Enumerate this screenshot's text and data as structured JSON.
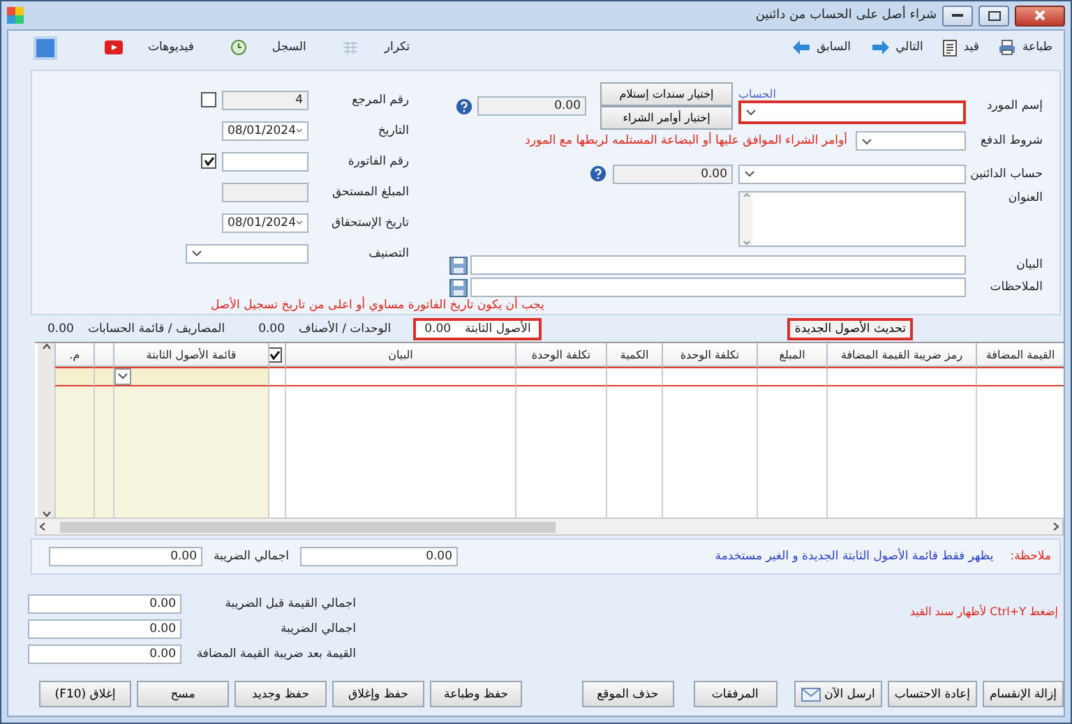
{
  "window": {
    "title": "شراء أصل على الحساب من دائنين"
  },
  "toolbar": {
    "right": [
      {
        "label": "طباعة",
        "kind": "printer"
      },
      {
        "label": "قيد",
        "kind": "ledger"
      },
      {
        "label": "التالي",
        "kind": "next"
      },
      {
        "label": "السابق",
        "kind": "previous"
      }
    ],
    "left": [
      {
        "label": "تكرار",
        "kind": "repeat"
      },
      {
        "label": "السجل",
        "kind": "history"
      },
      {
        "label": "فيديوهات",
        "kind": "video"
      }
    ]
  },
  "form": {
    "supplier": {
      "label": "إسم المورد",
      "link": "الحساب",
      "highlighted": true
    },
    "pick_buttons": [
      "إختيار سندات إستلام",
      "إختيار أوامر الشراء"
    ],
    "supplier_balance": "0.00",
    "payment_terms": {
      "label": "شروط الدفع"
    },
    "purchase_orders_hint": "أوامر الشراء الموافق عليها أو البضاعة المستلمه لربطها مع المورد",
    "payables_account": {
      "label": "حساب الدائنين",
      "value": "0.00"
    },
    "address": {
      "label": "العنوان"
    },
    "statement": {
      "label": "البيان"
    },
    "notes": {
      "label": "الملاحظات"
    },
    "reference": {
      "label": "رقم المرجع",
      "value": "4",
      "checked": false
    },
    "date": {
      "label": "التاريخ",
      "value": "08/01/2024"
    },
    "invoice_number": {
      "label": "رقم الفاتورة",
      "checked": true
    },
    "amount_due": {
      "label": "المبلغ المستحق"
    },
    "due_date": {
      "label": "تاريخ الإستحقاق",
      "value": "08/01/2024"
    },
    "category": {
      "label": "التصنيف"
    },
    "date_warning": "يجب أن يكون تاريخ الفاتورة مساوي أو اعلى من تاريخ تسجيل الأصل"
  },
  "refresh_button": {
    "label": "تحديث الأصول الجديدة",
    "highlighted": true
  },
  "strip": [
    {
      "label": "الأصول الثابتة",
      "value": "0.00",
      "highlighted": true
    },
    {
      "label": "الوحدات / الأصناف",
      "value": "0.00",
      "highlighted": false
    },
    {
      "label": "المصاريف / قائمة الحسابات",
      "value": "0.00",
      "highlighted": false
    }
  ],
  "table": {
    "columns": [
      {
        "kind": "text",
        "label": "القيمة المضافة"
      },
      {
        "kind": "text",
        "label": "رمز ضريبة القيمة المضافة"
      },
      {
        "kind": "text",
        "label": "المبلغ"
      },
      {
        "kind": "text",
        "label": "تكلفة الوحدة"
      },
      {
        "kind": "text",
        "label": "الكمية"
      },
      {
        "kind": "text",
        "label": "تكلفة الوحدة"
      },
      {
        "kind": "text",
        "label": "البيان"
      },
      {
        "kind": "checkbox",
        "checked": true
      },
      {
        "kind": "text",
        "label": "قائمة الأصول الثابتة"
      },
      {
        "kind": "spacer"
      },
      {
        "kind": "text",
        "label": "م."
      }
    ]
  },
  "note": {
    "label": "ملاحظة:",
    "text": "يظهر فقط قائمة الأصول الثابتة الجديدة و الغير مستخدمة",
    "amount": "0.00",
    "tax_label": "اجمالي الضريبة",
    "tax": "0.00"
  },
  "shortcut_hint": "إضغط Ctrl+Y لأظهار سند القيد",
  "totals": [
    {
      "label": "اجمالي القيمة قبل الضريبة",
      "value": "0.00"
    },
    {
      "label": "اجمالي الضريبة",
      "value": "0.00"
    },
    {
      "label": "القيمة بعد ضريبة القيمة المضافة",
      "value": "0.00"
    }
  ],
  "buttons_right": [
    {
      "label": "إزالة الإنقسام",
      "kind": "plain"
    },
    {
      "label": "إعادة الاحتساب",
      "kind": "plain"
    },
    {
      "label": "ارسل الآن",
      "kind": "send"
    },
    {
      "label": "المرفقات",
      "kind": "plain"
    },
    {
      "label": "حذف الموقع",
      "kind": "plain"
    }
  ],
  "buttons_left": [
    "حفظ وطباعة",
    "حفظ وإغلاق",
    "حفظ وجديد",
    "مسح",
    "إغلاق (F10)"
  ]
}
